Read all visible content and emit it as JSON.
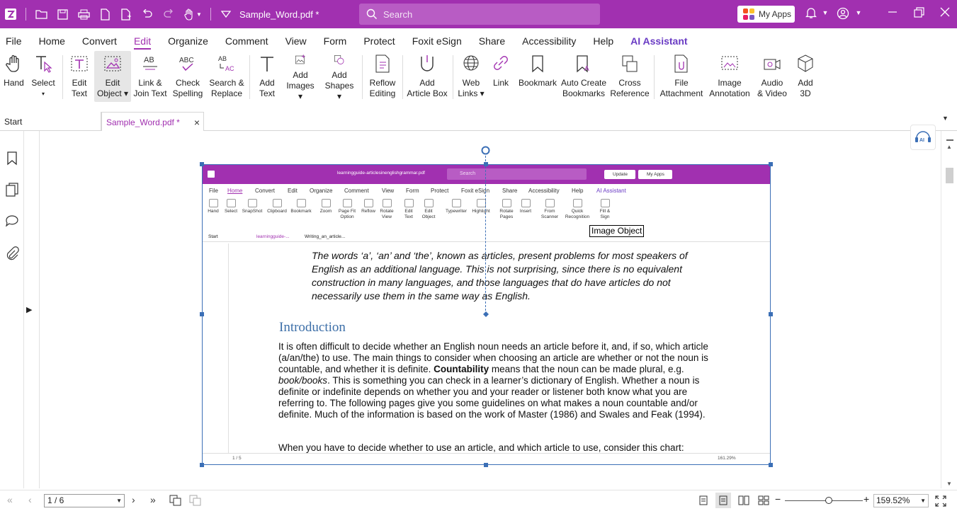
{
  "app": {
    "doc_title": "Sample_Word.pdf *"
  },
  "search": {
    "placeholder": "Search"
  },
  "titlebar": {
    "my_apps": "My Apps"
  },
  "menu": [
    "File",
    "Home",
    "Convert",
    "Edit",
    "Organize",
    "Comment",
    "View",
    "Form",
    "Protect",
    "Foxit eSign",
    "Share",
    "Accessibility",
    "Help",
    "AI Assistant"
  ],
  "ribbon": [
    {
      "l1": "Hand",
      "l2": ""
    },
    {
      "l1": "Select",
      "l2": "▾"
    },
    {
      "l1": "Edit",
      "l2": "Text"
    },
    {
      "l1": "Edit",
      "l2": "Object ▾"
    },
    {
      "l1": "Link &",
      "l2": "Join Text"
    },
    {
      "l1": "Check",
      "l2": "Spelling"
    },
    {
      "l1": "Search &",
      "l2": "Replace"
    },
    {
      "l1": "Add",
      "l2": "Text"
    },
    {
      "l1": "Add",
      "l2": "Images ▾"
    },
    {
      "l1": "Add",
      "l2": "Shapes ▾"
    },
    {
      "l1": "Reflow",
      "l2": "Editing"
    },
    {
      "l1": "Add",
      "l2": "Article Box"
    },
    {
      "l1": "Web",
      "l2": "Links ▾"
    },
    {
      "l1": "Link",
      "l2": ""
    },
    {
      "l1": "Bookmark",
      "l2": ""
    },
    {
      "l1": "Auto Create",
      "l2": "Bookmarks"
    },
    {
      "l1": "Cross",
      "l2": "Reference"
    },
    {
      "l1": "File",
      "l2": "Attachment"
    },
    {
      "l1": "Image",
      "l2": "Annotation"
    },
    {
      "l1": "Audio",
      "l2": "& Video"
    },
    {
      "l1": "Add",
      "l2": "3D"
    }
  ],
  "tabs": {
    "start": "Start",
    "doc": "Sample_Word.pdf *"
  },
  "embedded": {
    "doc_title": "learningguide-articlesinenglishgrammar.pdf",
    "search": "Search",
    "update": "Update",
    "my_apps": "My Apps",
    "menu": [
      "File",
      "Home",
      "Convert",
      "Edit",
      "Organize",
      "Comment",
      "View",
      "Form",
      "Protect",
      "Foxit eSign",
      "Share",
      "Accessibility",
      "Help",
      "AI Assistant"
    ],
    "ribbon": [
      "Hand",
      "Select",
      "SnapShot",
      "Clipboard",
      "Bookmark",
      "Zoom",
      "Page Fit Option",
      "Reflow",
      "Rotate View",
      "Edit Text",
      "Edit Object",
      "Typewriter",
      "Highlight",
      "Rotate Pages",
      "Insert",
      "From Scanner",
      "Quick Recognition",
      "Fill & Sign"
    ],
    "tabs": [
      "Start",
      "learningguide-...",
      "Writing_an_article..."
    ],
    "page_nav": "1 / 5",
    "zoom": "161.29%",
    "para1": "The words ‘a’, ‘an’ and ‘the’, known as articles, present problems for most speakers of English as an additional language. This is not surprising, since there is no equivalent construction in many languages, and those languages that do have articles do not necessarily use them in the same way as English.",
    "heading": "Introduction",
    "body_1": "It is often difficult to decide whether an English noun needs an article before it, and, if so, which article (a/an/the) to use. The main things to consider when choosing an article are whether or not the noun is countable, and whether it is definite. ",
    "body_bold": "Countability",
    "body_2": " means that the noun can be made plural, e.g. ",
    "body_ital": "book/books",
    "body_3": ". This is something you can check in a learner’s dictionary of English. Whether a noun is definite or indefinite depends on whether you and your reader or listener both know what you are referring to. The following pages give you some guidelines on what makes a noun countable and/or definite. Much of the information is based on the work of Master (1986) and Swales and Feak (1994).",
    "last": "When you have to decide whether to use an article, and which article to use, consider this chart:"
  },
  "tooltip": "Image Object",
  "status": {
    "page": "1 / 6",
    "zoom": "159.52%"
  }
}
